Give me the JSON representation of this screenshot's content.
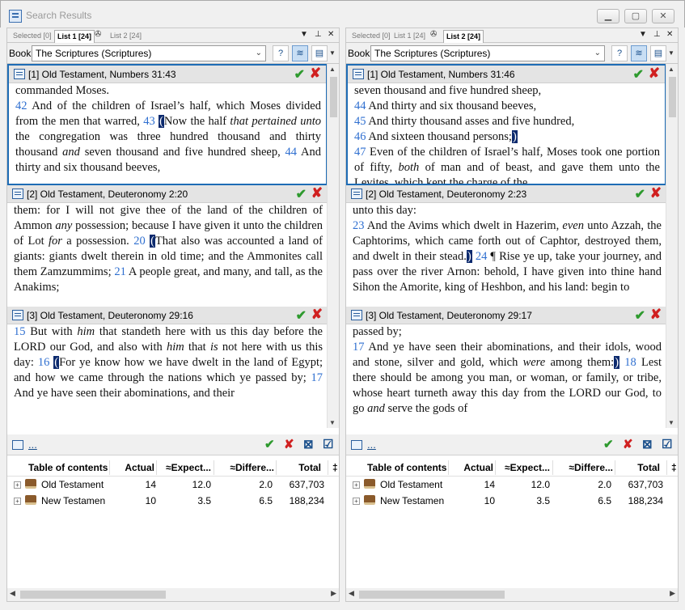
{
  "window": {
    "title": "Search Results",
    "min": "▁",
    "max": "▢",
    "close": "✕"
  },
  "panels": [
    {
      "tabs": {
        "selected": "Selected [0]",
        "list1": "List 1 [24]",
        "list2": "List 2 [24]",
        "active": "list1"
      },
      "book_label": "Book:",
      "book_value": "The Scriptures (Scriptures)",
      "results": [
        {
          "title": "[1] Old Testament, Numbers 31:43",
          "html": "<span class='first'>commanded Moses.</span><span class='vn'>42</span> And of the children of Israel’s half, which Moses divided from the men that warred, <span class='vn'>43</span> <span class='hl'>(</span>Now the half <i>that pertained unto</i> the congregation was three hundred thousand and thirty thousand <i>and</i> seven thousand and five hundred sheep, <span class='vn'>44</span> And thirty and six thousand beeves,"
        },
        {
          "title": "[2] Old Testament, Deuteronomy 2:20",
          "html": "them: for I will not give thee of the land of the children of Ammon <i>any</i> possession; because I have given it unto the children of Lot <i>for</i> a possession. <span class='vn'>20</span> <span class='hl'>(</span>That also was accounted a land of giants: giants dwelt therein in old time; and the Ammonites call them Zamzummims; <span class='vn'>21</span> A people great, and many, and tall, as the Anakims;"
        },
        {
          "title": "[3] Old Testament, Deuteronomy 29:16",
          "html": "<span class='vn'>15</span> But with <i>him</i> that standeth here with us this day before the LORD our God, and also with <i>him</i> that <i>is</i> not here with us this day: <span class='vn'>16</span> <span class='hl'>(</span>For ye know how we have dwelt in the land of Egypt; and how we came through the nations which ye passed by; <span class='vn'>17</span> And ye have seen their abominations, and their"
        }
      ],
      "link": "...",
      "columns": [
        "Table of contents",
        "Actual",
        "≈Expect...",
        "≈Differe...",
        "Total"
      ],
      "rows": [
        {
          "name": "Old Testament",
          "actual": "14",
          "expected": "12.0",
          "difference": "2.0",
          "total": "637,703"
        },
        {
          "name": "New Testamen",
          "actual": "10",
          "expected": "3.5",
          "difference": "6.5",
          "total": "188,234"
        }
      ]
    },
    {
      "tabs": {
        "selected": "Selected [0]",
        "list1": "List 1 [24]",
        "list2": "List 2 [24]",
        "active": "list2"
      },
      "book_label": "Book:",
      "book_value": "The Scriptures (Scriptures)",
      "results": [
        {
          "title": "[1] Old Testament, Numbers 31:46",
          "html": "<span class='first'>seven thousand and five hundred sheep,</span><span class='first'><span class='vn'>44</span> And thirty and six thousand beeves,</span><span class='first'><span class='vn'>45</span> And thirty thousand asses and five hundred,</span><span class='first'><span class='vn'>46</span> And sixteen thousand persons;<span class='hl'>)</span></span><span class='vn'>47</span> Even of the children of Israel’s half, Moses took one portion of fifty, <i>both</i> of man and of beast, and gave them unto the Levites, which kept the charge of the"
        },
        {
          "title": "[2] Old Testament, Deuteronomy 2:23",
          "html": "<span class='first'>unto this day:</span><span class='vn'>23</span> And the Avims which dwelt in Hazerim, <i>even</i> unto Azzah, the Caphtorims, which came forth out of Caphtor, destroyed them, and dwelt in their stead.<span class='hl'>)</span> <span class='vn'>24</span> ¶ Rise ye up, take your journey, and pass over the river Arnon: behold, I have given into thine hand Sihon the Amorite, king of Heshbon, and his land: begin to"
        },
        {
          "title": "[3] Old Testament, Deuteronomy 29:17",
          "html": "<span class='first'>passed by;</span><span class='vn'>17</span> And ye have seen their abominations, and their idols, wood and stone, silver and gold, which <i>were</i> among them:<span class='hl'>)</span> <span class='vn'>18</span> Lest there should be among you man, or woman, or family, or tribe, whose heart turneth away this day from the LORD our God, to go <i>and</i> serve the gods of"
        }
      ],
      "link": "...",
      "columns": [
        "Table of contents",
        "Actual",
        "≈Expect...",
        "≈Differe...",
        "Total"
      ],
      "rows": [
        {
          "name": "Old Testament",
          "actual": "14",
          "expected": "12.0",
          "difference": "2.0",
          "total": "637,703"
        },
        {
          "name": "New Testamen",
          "actual": "10",
          "expected": "3.5",
          "difference": "6.5",
          "total": "188,234"
        }
      ]
    }
  ]
}
